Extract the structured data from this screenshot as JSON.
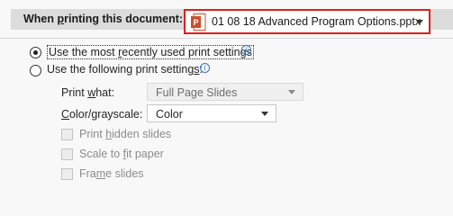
{
  "section": {
    "label_prefix": "When ",
    "label_underlined": "p",
    "label_suffix": "rinting this document:",
    "document_select": {
      "value": "01 08 18 Advanced Program Options.pptx",
      "icon": "powerpoint-file-icon",
      "highlight_color": "#e01e1e"
    }
  },
  "options": {
    "recent": {
      "pre": "Use the most ",
      "u": "r",
      "post": "ecently used print settings",
      "checked": true,
      "info_icon": "info-icon"
    },
    "following": {
      "pre": "Use the following print setting",
      "u": "s",
      "post": ":",
      "checked": false,
      "info_icon": "info-icon"
    }
  },
  "print_what": {
    "label_pre": "Print ",
    "label_u": "w",
    "label_post": "hat:",
    "value": "Full Page Slides"
  },
  "color": {
    "label_u": "C",
    "label_post": "olor/grayscale:",
    "value": "Color"
  },
  "checkboxes": [
    {
      "pre": "Print ",
      "u": "h",
      "post": "idden slides",
      "checked": false
    },
    {
      "pre": "Scale to ",
      "u": "f",
      "post": "it paper",
      "checked": false
    },
    {
      "pre": "Fra",
      "u": "m",
      "post": "e slides",
      "checked": false
    }
  ],
  "colors": {
    "accent_info": "#3b73c9",
    "header_band": "#dcdcdc"
  }
}
